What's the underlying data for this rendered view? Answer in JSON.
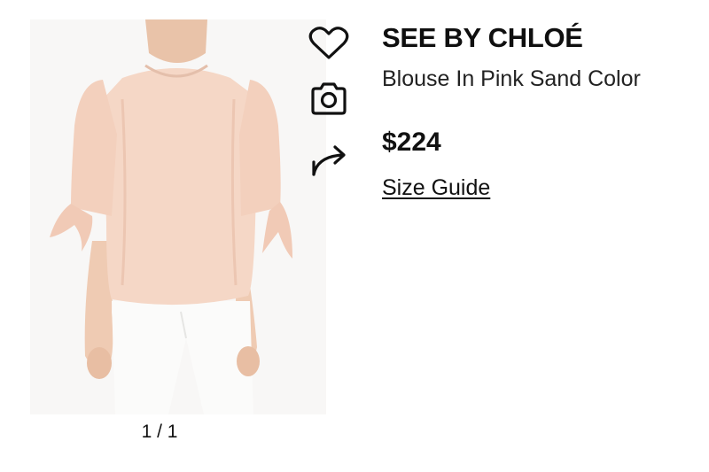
{
  "product": {
    "brand": "SEE BY CHLOÉ",
    "name": "Blouse In Pink Sand Color",
    "price": "$224",
    "size_guide_label": "Size Guide",
    "image_counter": "1 / 1",
    "garment_color": "#f5d7c6"
  },
  "actions": [
    {
      "icon": "heart-icon"
    },
    {
      "icon": "camera-icon"
    },
    {
      "icon": "share-icon"
    }
  ]
}
